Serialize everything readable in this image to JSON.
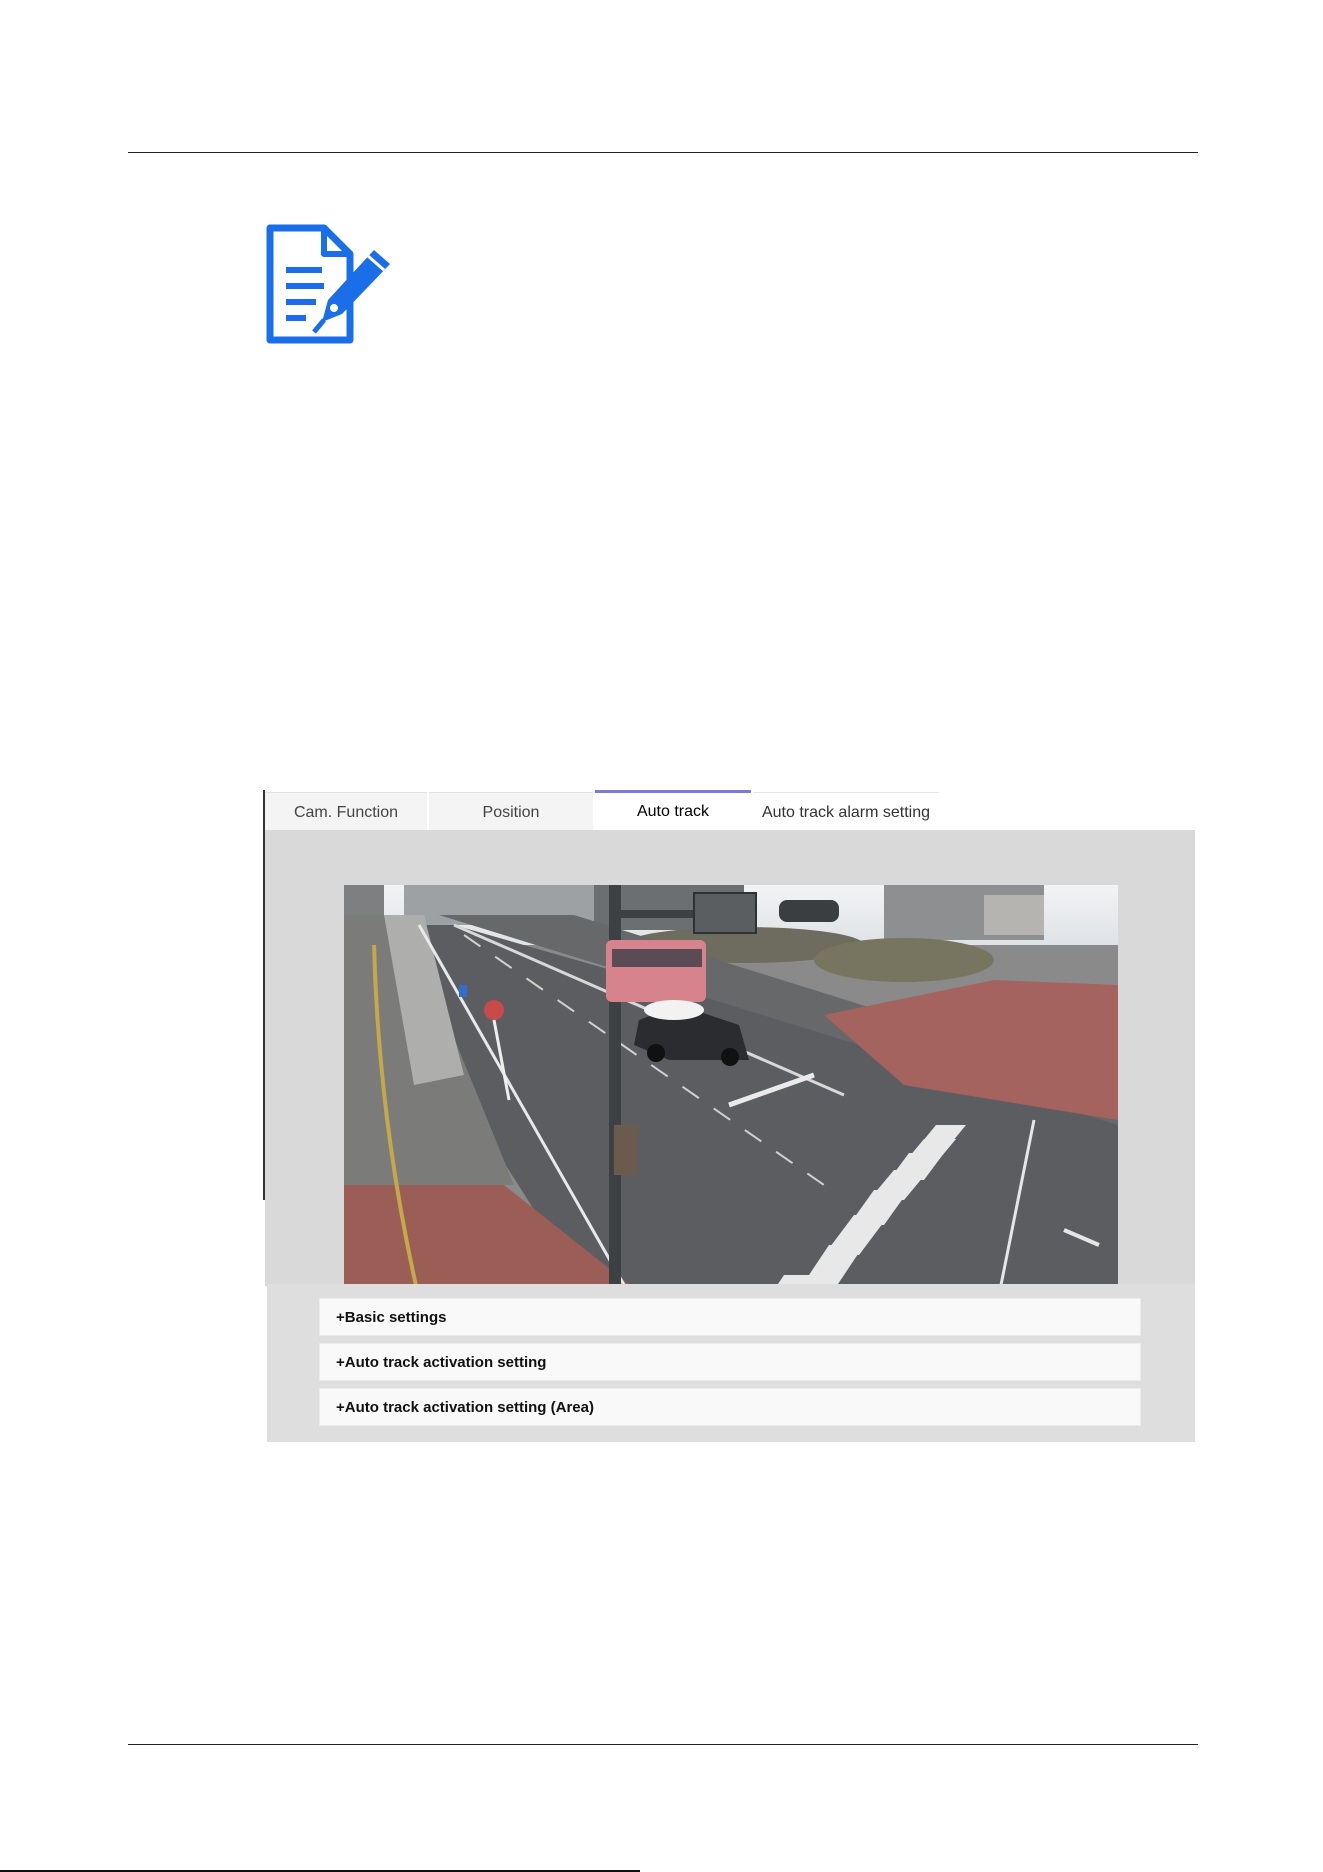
{
  "note": {
    "icon": "note-pen-icon",
    "color": "#1a6fe8"
  },
  "tabs": [
    {
      "label": "Cam. Function",
      "active": false
    },
    {
      "label": "Position",
      "active": false
    },
    {
      "label": "Auto track",
      "active": true
    },
    {
      "label": "Auto track alarm setting",
      "active": false
    }
  ],
  "camera": {
    "icon": "camera-live-image"
  },
  "sections": [
    {
      "label": "+Basic settings"
    },
    {
      "label": "+Auto track activation setting"
    },
    {
      "label": "+Auto track activation setting (Area)"
    }
  ],
  "colors": {
    "accent": "#7d78e0",
    "panel_bg": "#d9d9d9"
  }
}
